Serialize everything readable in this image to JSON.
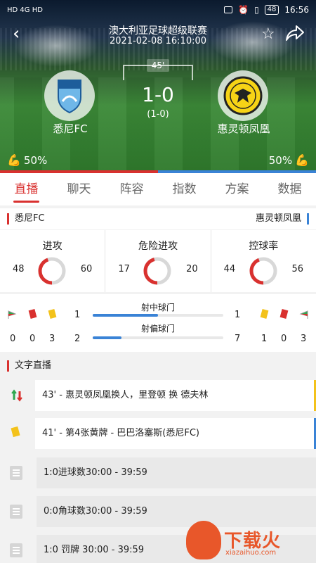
{
  "status_bar": {
    "left": "HD 4G HD",
    "right_time": "16:56",
    "battery": "48"
  },
  "header": {
    "league": "澳大利亚足球超级联赛",
    "datetime": "2021-02-08 16:10:00",
    "minute": "45'",
    "score": "1-0",
    "half_score": "(1-0)",
    "home": {
      "name": "悉尼FC",
      "possession": "50%"
    },
    "away": {
      "name": "惠灵顿凤凰",
      "possession": "50%"
    },
    "possession_split": 0.5
  },
  "tabs": [
    "直播",
    "聊天",
    "阵容",
    "指数",
    "方案",
    "数据"
  ],
  "teams_row": {
    "home": "悉尼FC",
    "away": "惠灵顿凤凰"
  },
  "stats": [
    {
      "title": "进攻",
      "home": "48",
      "away": "60"
    },
    {
      "title": "危险进攻",
      "home": "17",
      "away": "20"
    },
    {
      "title": "控球率",
      "home": "44",
      "away": "56"
    }
  ],
  "events": {
    "home_counts_top": [
      "1"
    ],
    "away_counts_top": [
      "1"
    ],
    "home_counts_bottom": [
      "0",
      "0",
      "3",
      "2"
    ],
    "away_counts_bottom": [
      "7",
      "1",
      "0",
      "3"
    ],
    "shots_on_target": {
      "label": "射中球门",
      "home": 1,
      "away": 1
    },
    "shots_off_target": {
      "label": "射偏球门",
      "home": 2,
      "away": 7
    }
  },
  "live": {
    "title": "文字直播",
    "items": [
      {
        "text": "43' - 惠灵顿凤凰换人，里登顿 换 德夫林",
        "icon": "substitution-icon"
      },
      {
        "text": "41' - 第4张黄牌 - 巴巴洛塞斯(悉尼FC)",
        "icon": "yellow-card-icon"
      },
      {
        "text": "1:0进球数30:00 - 39:59",
        "icon": "document-icon"
      },
      {
        "text": "0:0角球数30:00 - 39:59",
        "icon": "document-icon"
      },
      {
        "text": "1:0 罚牌 30:00 - 39:59",
        "icon": "document-icon"
      }
    ]
  },
  "watermark": {
    "text": "下载火",
    "sub": "xiazaihuo.com"
  },
  "colors": {
    "home": "#d9312f",
    "away": "#3a83d6",
    "yellow": "#f3c21b"
  }
}
